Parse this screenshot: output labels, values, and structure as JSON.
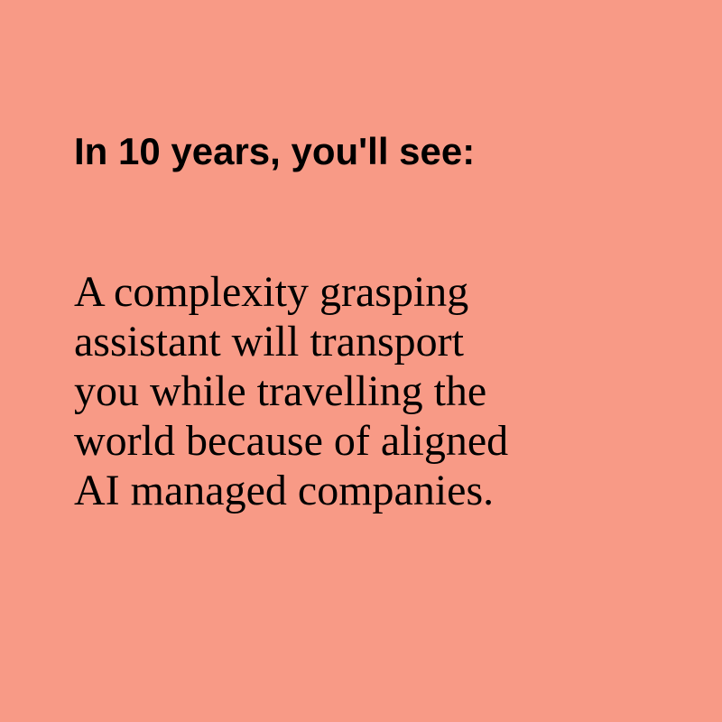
{
  "background_color": "#f89a86",
  "text_color": "#000000",
  "heading": "In 10 years, you'll see:",
  "body_lines": [
    "A complexity grasping",
    "assistant will transport",
    "you while travelling the",
    "world because of aligned",
    "AI managed companies."
  ]
}
